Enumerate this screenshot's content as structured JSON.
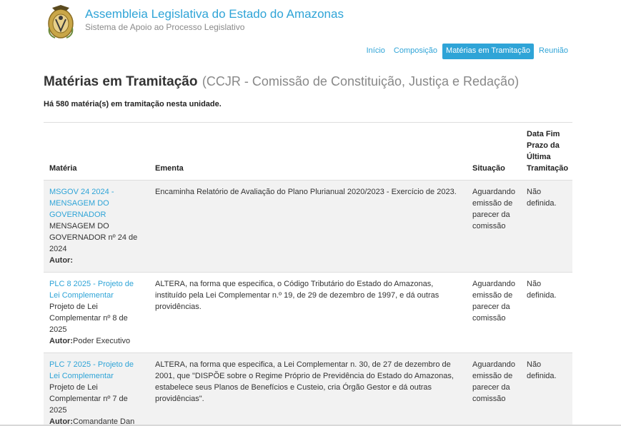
{
  "header": {
    "title": "Assembleia Legislativa do Estado do Amazonas",
    "subtitle": "Sistema de Apoio ao Processo Legislativo",
    "logo_icon": "coat-of-arms-icon"
  },
  "nav": {
    "items": [
      {
        "label": "Início",
        "active": false
      },
      {
        "label": "Composição",
        "active": false
      },
      {
        "label": "Matérias em Tramitação",
        "active": true
      },
      {
        "label": "Reunião",
        "active": false
      }
    ]
  },
  "page": {
    "title": "Matérias em Tramitação",
    "subtitle": "(CCJR - Comissão de Constituição, Justiça e Redação)",
    "count_text": "Há 580 matéria(s) em tramitação nesta unidade."
  },
  "table": {
    "headers": {
      "materia": "Matéria",
      "ementa": "Ementa",
      "situacao": "Situação",
      "prazo": "Data Fim Prazo da Última Tramitação"
    },
    "autor_label": "Autor:",
    "rows": [
      {
        "link": "MSGOV 24 2024 - MENSAGEM DO GOVERNADOR",
        "desc": "MENSAGEM DO GOVERNADOR nº 24 de 2024",
        "autor": "",
        "ementa": "Encaminha Relatório de Avaliação do Plano Plurianual 2020/2023 - Exercício de 2023.",
        "situacao": "Aguardando emissão de parecer da comissão",
        "prazo": "Não definida."
      },
      {
        "link": "PLC 8 2025 - Projeto de Lei Complementar",
        "desc": "Projeto de Lei Complementar nº 8 de 2025",
        "autor": "Poder Executivo",
        "ementa": "ALTERA, na forma que especifica, o Código Tributário do Estado do Amazonas, instituído pela Lei Complementar n.º 19, de 29 de dezembro de 1997, e dá outras providências.",
        "situacao": "Aguardando emissão de parecer da comissão",
        "prazo": "Não definida."
      },
      {
        "link": "PLC 7 2025 - Projeto de Lei Complementar",
        "desc": "Projeto de Lei Complementar nº 7 de 2025",
        "autor": "Comandante Dan",
        "ementa": "ALTERA, na forma que especifica, a Lei Complementar n. 30, de 27 de dezembro de 2001, que \"DISPÕE sobre o Regime Próprio de Previdência do Estado do Amazonas, estabelece seus Planos de Benefícios e Custeio, cria Órgão Gestor e dá outras providências\".",
        "situacao": "Aguardando emissão de parecer da comissão",
        "prazo": "Não definida."
      }
    ]
  },
  "colors": {
    "accent": "#2fa4d7",
    "row_shade": "#f2f2f2",
    "border": "#dddddd"
  }
}
